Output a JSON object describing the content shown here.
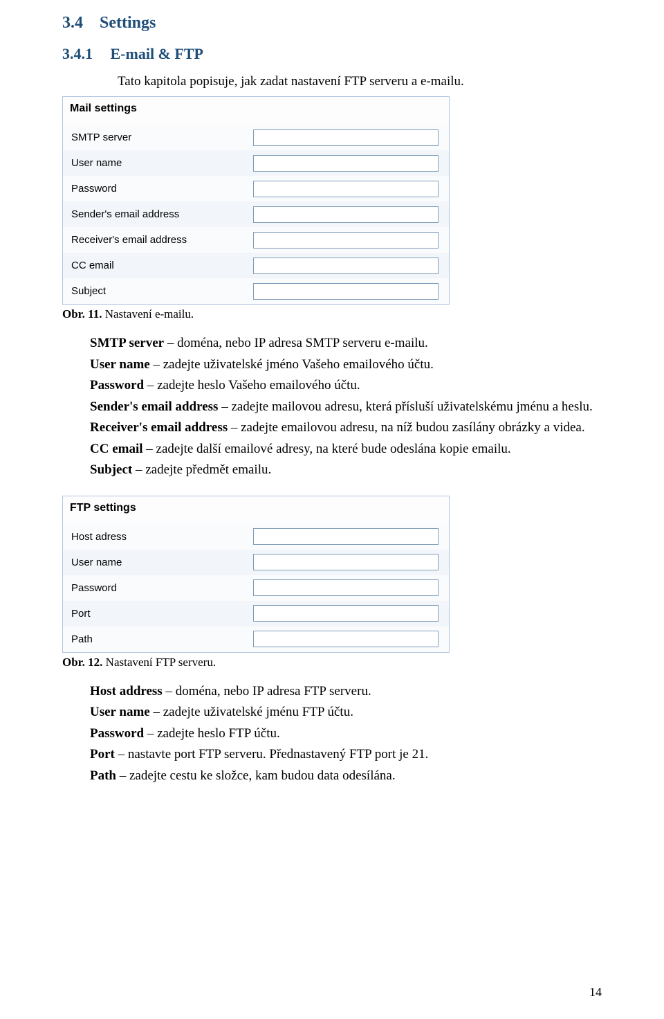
{
  "headings": {
    "h2_num": "3.4",
    "h2_text": "Settings",
    "h3_num": "3.4.1",
    "h3_text": "E-mail & FTP"
  },
  "intro_text": "Tato kapitola popisuje, jak zadat nastavení FTP serveru a e-mailu.",
  "mail_panel": {
    "title": "Mail settings",
    "fields": {
      "smtp": "SMTP server",
      "user": "User name",
      "pass": "Password",
      "sender": "Sender's email address",
      "receiver": "Receiver's email address",
      "cc": "CC email",
      "subject": "Subject"
    }
  },
  "caption1": {
    "bold": "Obr. 11.",
    "rest": " Nastavení e-mailu."
  },
  "desc1": {
    "l1b": "SMTP server",
    "l1": " – doména, nebo IP adresa SMTP serveru e-mailu.",
    "l2b": "User name",
    "l2": " – zadejte uživatelské jméno Vašeho emailového účtu.",
    "l3b": "Password",
    "l3": " – zadejte heslo Vašeho emailového účtu.",
    "l4b": "Sender's email address",
    "l4": " – zadejte mailovou adresu, která přísluší uživatelskému jménu a heslu.",
    "l5b": "Receiver's email address",
    "l5": " – zadejte emailovou adresu, na níž budou zasílány obrázky a videa.",
    "l6b": "CC email",
    "l6": " – zadejte další emailové adresy, na které bude odeslána kopie emailu.",
    "l7b": "Subject",
    "l7": " – zadejte předmět emailu."
  },
  "ftp_panel": {
    "title": "FTP settings",
    "fields": {
      "host": "Host adress",
      "user": "User name",
      "pass": "Password",
      "port": "Port",
      "path": "Path"
    }
  },
  "caption2": {
    "bold": "Obr. 12.",
    "rest": " Nastavení FTP serveru."
  },
  "desc2": {
    "l1b": "Host address",
    "l1": " – doména, nebo IP adresa FTP serveru.",
    "l2b": "User name",
    "l2": " – zadejte uživatelské jménu FTP účtu.",
    "l3b": "Password",
    "l3": " – zadejte heslo FTP účtu.",
    "l4b": "Port",
    "l4": " – nastavte port FTP serveru. Přednastavený FTP port je 21.",
    "l5b": "Path",
    "l5": " – zadejte cestu ke složce, kam budou data odesílána."
  },
  "page_number": "14"
}
